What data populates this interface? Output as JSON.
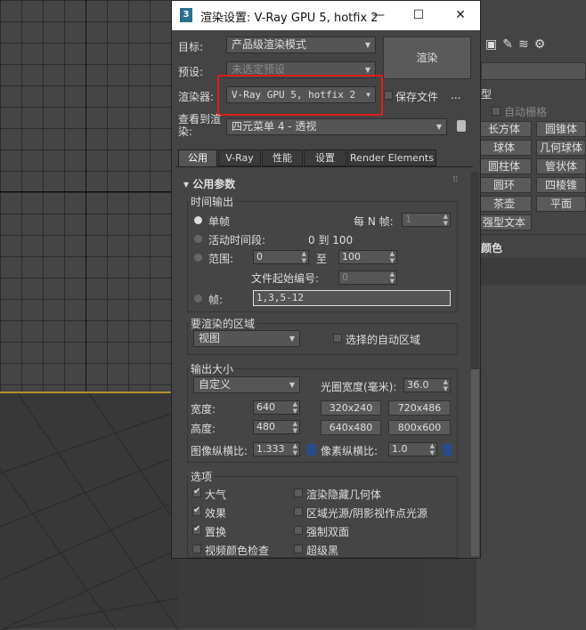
{
  "window": {
    "title": "渲染设置: V-Ray GPU 5, hotfix 2",
    "minimize": "—",
    "maximize": "☐",
    "close": "✕",
    "icon": "3"
  },
  "top": {
    "target_label": "目标:",
    "target_value": "产品级渲染模式",
    "preset_label": "预设:",
    "preset_value": "未选定预设",
    "renderer_label": "渲染器:",
    "renderer_value": "V-Ray GPU 5, hotfix 2",
    "save_file_label": "保存文件",
    "more": "...",
    "view_label": "查看到渲\n染:",
    "view_value": "四元菜单 4 - 透视",
    "render_button": "渲染"
  },
  "tabs": [
    "公用",
    "V-Ray",
    "性能",
    "设置",
    "Render Elements"
  ],
  "rollout_title": "公用参数",
  "time_output": {
    "title": "时间输出",
    "single": "单帧",
    "every_n": "每 N 帧:",
    "every_n_value": "1",
    "active_segment": "活动时间段:",
    "active_range": "0 到 100",
    "range": "范围:",
    "range_from": "0",
    "range_to_label": "至",
    "range_to": "100",
    "file_start": "文件起始编号:",
    "file_start_value": "0",
    "frames": "帧:",
    "frames_value": "1,3,5-12"
  },
  "area": {
    "title": "要渲染的区域",
    "value": "视图",
    "auto_region": "选择的自动区域"
  },
  "output_size": {
    "title": "输出大小",
    "preset": "自定义",
    "aperture_label": "光圈宽度(毫米):",
    "aperture_value": "36.0",
    "width_label": "宽度:",
    "width_value": "640",
    "height_label": "高度:",
    "height_value": "480",
    "presets": [
      "320x240",
      "720x486",
      "640x480",
      "800x600"
    ],
    "image_aspect_label": "图像纵横比:",
    "image_aspect_value": "1.333",
    "pixel_aspect_label": "像素纵横比:",
    "pixel_aspect_value": "1.0"
  },
  "options": {
    "title": "选项",
    "items": [
      {
        "label": "大气",
        "checked": true
      },
      {
        "label": "渲染隐藏几何体",
        "checked": false
      },
      {
        "label": "效果",
        "checked": true
      },
      {
        "label": "区域光源/阴影视作点光源",
        "checked": false
      },
      {
        "label": "置换",
        "checked": true
      },
      {
        "label": "强制双面",
        "checked": false
      },
      {
        "label": "视频颜色检查",
        "checked": false
      },
      {
        "label": "超级黑",
        "checked": false
      }
    ]
  },
  "right_panel": {
    "auto_grid": "自动栅格",
    "section_title": "型",
    "buttons": [
      "长方体",
      "圆锥体",
      "球体",
      "几何球体",
      "圆柱体",
      "管状体",
      "圆环",
      "四棱锥",
      "茶壶",
      "平面"
    ],
    "text_button": "强型文本",
    "color_title": "颜色"
  },
  "colors": {
    "highlight": "#e01b1b",
    "panel": "#444444"
  }
}
